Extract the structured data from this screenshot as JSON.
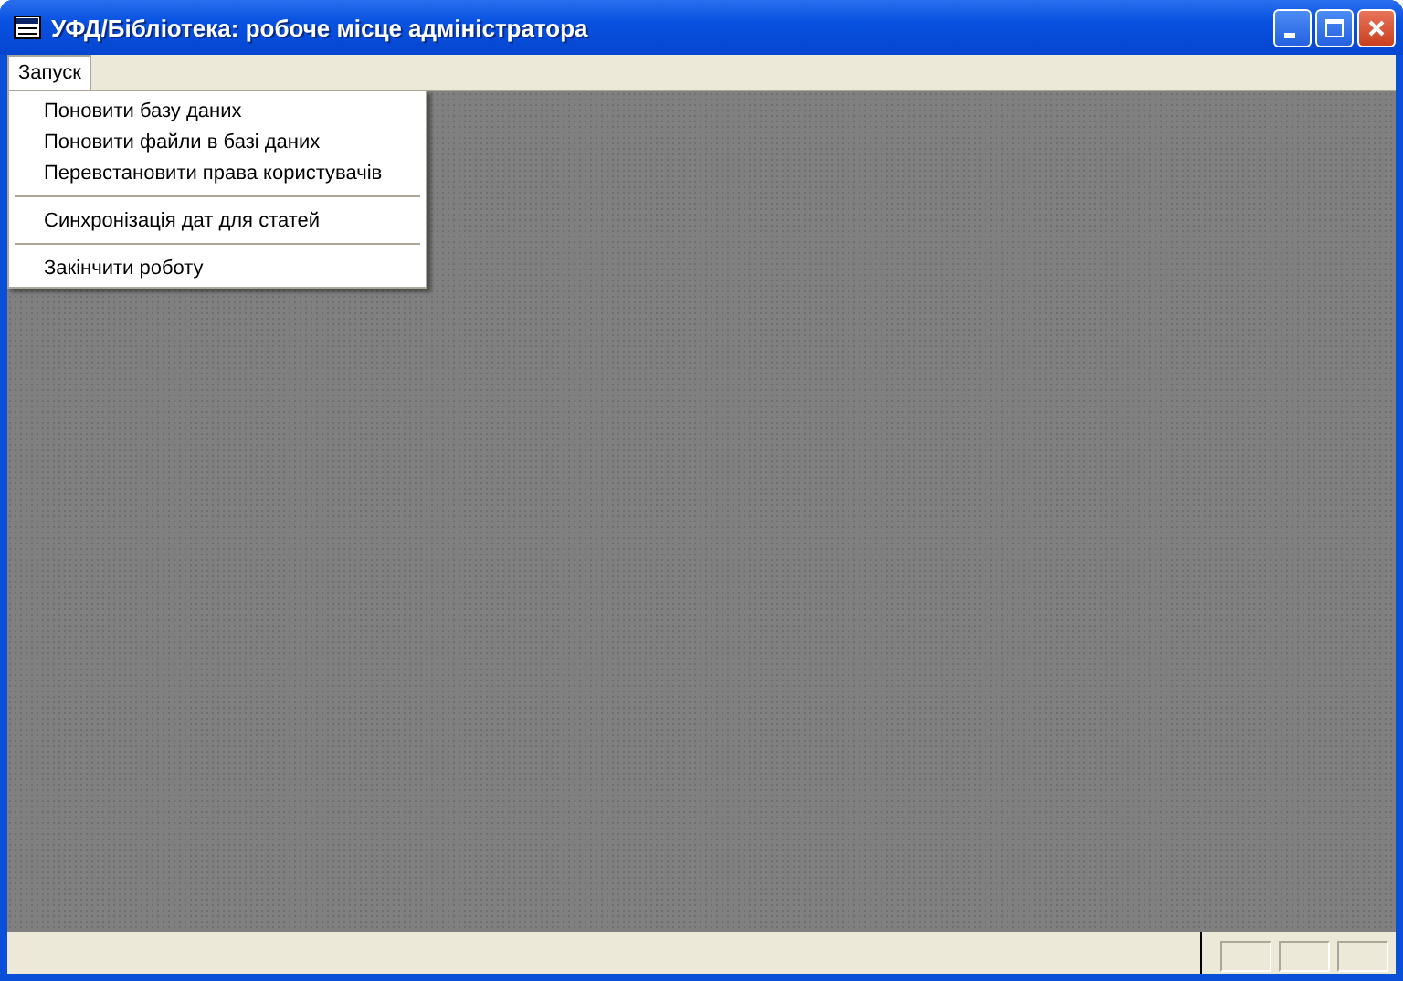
{
  "window": {
    "title": "УФД/Бібліотека: робоче місце адміністратора"
  },
  "menu_bar": [
    {
      "label": "Запуск",
      "expanded": true,
      "items": [
        {
          "kind": "item",
          "label": "Поновити базу даних"
        },
        {
          "kind": "item",
          "label": "Поновити файли в базі даних"
        },
        {
          "kind": "item",
          "label": "Перевстановити права користувачів"
        },
        {
          "kind": "separator"
        },
        {
          "kind": "item",
          "label": "Синхронізація дат для статей"
        },
        {
          "kind": "separator"
        },
        {
          "kind": "item",
          "label": "Закінчити роботу"
        }
      ]
    }
  ]
}
